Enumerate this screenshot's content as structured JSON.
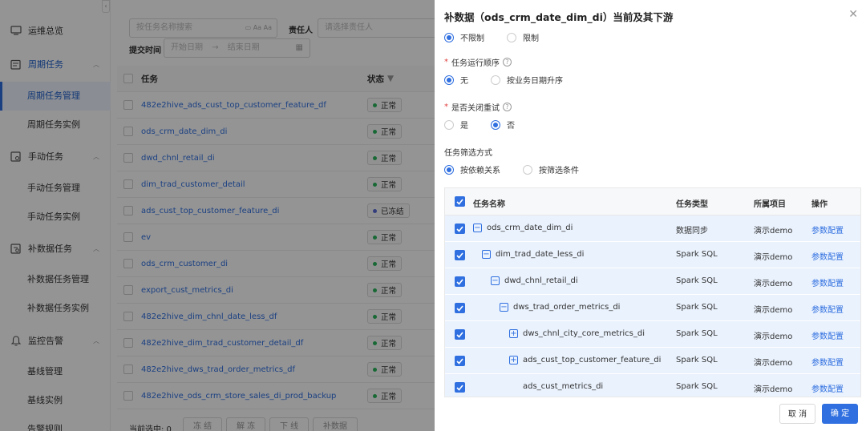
{
  "sidebar": {
    "collapse": "‹",
    "groups": [
      {
        "label": "运维总览"
      },
      {
        "label": "周期任务"
      },
      {
        "label": "手动任务"
      },
      {
        "label": "补数据任务"
      },
      {
        "label": "监控告警"
      }
    ],
    "items": [
      {
        "label": "周期任务管理"
      },
      {
        "label": "周期任务实例"
      },
      {
        "label": "手动任务管理"
      },
      {
        "label": "手动任务实例"
      },
      {
        "label": "补数据任务管理"
      },
      {
        "label": "补数据任务实例"
      },
      {
        "label": "基线管理"
      },
      {
        "label": "基线实例"
      },
      {
        "label": "告警规则"
      }
    ]
  },
  "filters": {
    "search_placeholder": "按任务名称搜索",
    "owner_label": "责任人",
    "owner_placeholder": "请选择责任人",
    "submit_time_label": "提交时间",
    "start_placeholder": "开始日期",
    "end_placeholder": "结束日期",
    "arrow": "→"
  },
  "table": {
    "col_task": "任务",
    "col_status": "状态",
    "rows": [
      {
        "name": "482e2hive_ads_cust_top_customer_feature_df",
        "status": "正常"
      },
      {
        "name": "ods_crm_date_dim_di",
        "status": "正常"
      },
      {
        "name": "dwd_chnl_retail_di",
        "status": "正常"
      },
      {
        "name": "dim_trad_customer_detail",
        "status": "正常"
      },
      {
        "name": "ads_cust_top_customer_feature_di",
        "status": "已冻结"
      },
      {
        "name": "ev",
        "status": "正常"
      },
      {
        "name": "ods_crm_customer_di",
        "status": "正常"
      },
      {
        "name": "export_cust_metrics_di",
        "status": "正常"
      },
      {
        "name": "482e2hive_dim_chnl_date_less_df",
        "status": "正常"
      },
      {
        "name": "482e2hive_dim_trad_customer_detail_df",
        "status": "正常"
      },
      {
        "name": "482e2hive_dws_trad_order_metrics_df",
        "status": "正常"
      },
      {
        "name": "482e2hive_ods_crm_store_sales_di_prod_backup",
        "status": "正常"
      }
    ]
  },
  "footer": {
    "selected_text": "当前选中: 0",
    "btn_freeze": "冻 结",
    "btn_unfreeze": "解 冻",
    "btn_offline": "下 线",
    "btn_backfill": "补数据"
  },
  "drawer": {
    "title": "补数据（ods_crm_date_dim_di）当前及其下游",
    "close": "✕",
    "limit": {
      "opt1": "不限制",
      "opt2": "限制"
    },
    "order": {
      "label": "任务运行顺序",
      "opt1": "无",
      "opt2": "按业务日期升序"
    },
    "retry": {
      "label": "是否关闭重试",
      "opt1": "是",
      "opt2": "否"
    },
    "filter": {
      "label": "任务筛选方式",
      "opt1": "按依赖关系",
      "opt2": "按筛选条件"
    },
    "grid": {
      "headers": {
        "name": "任务名称",
        "type": "任务类型",
        "project": "所属项目",
        "op": "操作"
      },
      "rows": [
        {
          "name": "ods_crm_date_dim_di",
          "type": "数据同步",
          "project": "演示demo",
          "op": "参数配置",
          "exp": "−"
        },
        {
          "name": "dim_trad_date_less_di",
          "type": "Spark SQL",
          "project": "演示demo",
          "op": "参数配置",
          "exp": "−"
        },
        {
          "name": "dwd_chnl_retail_di",
          "type": "Spark SQL",
          "project": "演示demo",
          "op": "参数配置",
          "exp": "−"
        },
        {
          "name": "dws_trad_order_metrics_di",
          "type": "Spark SQL",
          "project": "演示demo",
          "op": "参数配置",
          "exp": "−"
        },
        {
          "name": "dws_chnl_city_core_metrics_di",
          "type": "Spark SQL",
          "project": "演示demo",
          "op": "参数配置",
          "exp": "+"
        },
        {
          "name": "ads_cust_top_customer_feature_di",
          "type": "Spark SQL",
          "project": "演示demo",
          "op": "参数配置",
          "exp": "+"
        },
        {
          "name": "ads_cust_metrics_di",
          "type": "Spark SQL",
          "project": "演示demo",
          "op": "参数配置",
          "exp": ""
        }
      ]
    },
    "cancel": "取 消",
    "confirm": "确 定"
  }
}
